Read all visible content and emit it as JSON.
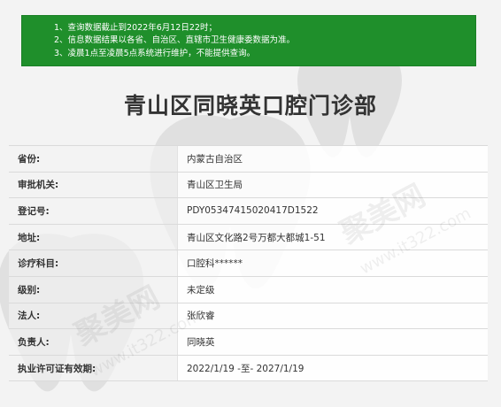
{
  "notice": {
    "lines": [
      "1、查询数据截止到2022年6月12日22时；",
      "2、信息数据结果以各省、自治区、直辖市卫生健康委数据为准。",
      "3、凌晨1点至凌晨5点系统进行维护，不能提供查询。"
    ]
  },
  "title": "青山区同晓英口腔门诊部",
  "rows": [
    {
      "label": "省份:",
      "value": "内蒙古自治区"
    },
    {
      "label": "审批机关:",
      "value": "青山区卫生局"
    },
    {
      "label": "登记号:",
      "value": "PDY05347415020417D1522"
    },
    {
      "label": "地址:",
      "value": "青山区文化路2号万都大都城1-51"
    },
    {
      "label": "诊疗科目:",
      "value": "口腔科******"
    },
    {
      "label": "级别:",
      "value": "未定级"
    },
    {
      "label": "法人:",
      "value": "张欣睿"
    },
    {
      "label": "负责人:",
      "value": "同晓英"
    },
    {
      "label": "执业许可证有效期:",
      "value": "2022/1/19 -至- 2027/1/19"
    }
  ],
  "watermark": {
    "brand": "聚美网",
    "url": "www.it322.com"
  },
  "colors": {
    "notice_bg": "#1f8f2b",
    "text": "#333333"
  }
}
